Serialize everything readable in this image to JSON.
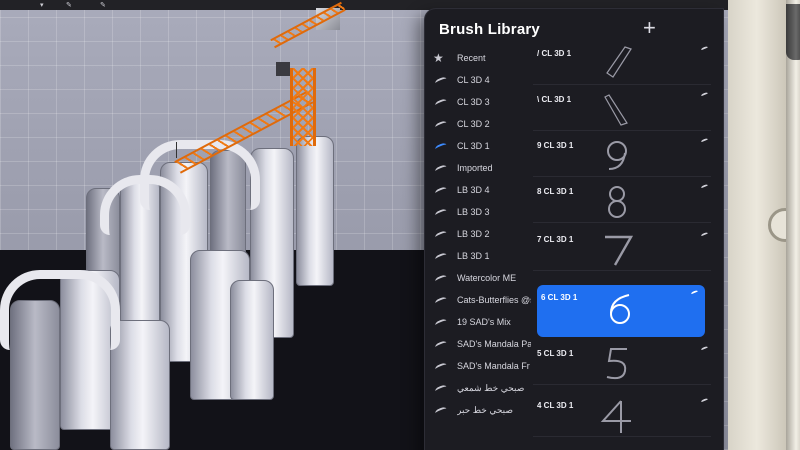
{
  "app": {
    "panel_title": "Brush Library",
    "add_button_label": "+"
  },
  "brush_sets": [
    {
      "label": "Recent",
      "icon": "star-icon"
    },
    {
      "label": "CL 3D 4",
      "icon": "brush-stroke-icon"
    },
    {
      "label": "CL 3D 3",
      "icon": "brush-stroke-icon"
    },
    {
      "label": "CL 3D 2",
      "icon": "brush-stroke-icon"
    },
    {
      "label": "CL 3D 1",
      "icon": "brush-stroke-icon",
      "active": true
    },
    {
      "label": "Imported",
      "icon": "brush-stroke-icon"
    },
    {
      "label": "LB 3D 4",
      "icon": "brush-stroke-icon"
    },
    {
      "label": "LB 3D 3",
      "icon": "brush-stroke-icon"
    },
    {
      "label": "LB 3D 2",
      "icon": "brush-stroke-icon"
    },
    {
      "label": "LB 3D 1",
      "icon": "brush-stroke-icon"
    },
    {
      "label": "Watercolor ME",
      "icon": "brush-stroke-icon"
    },
    {
      "label": "Cats-Butterflies @su...",
      "icon": "brush-stroke-icon"
    },
    {
      "label": "19 SAD's Mix",
      "icon": "brush-stroke-icon"
    },
    {
      "label": "SAD's Mandala Pa",
      "icon": "brush-stroke-icon"
    },
    {
      "label": "SAD's Mandala Fr",
      "icon": "brush-stroke-icon"
    },
    {
      "label": "صبحي خط شمعي",
      "icon": "brush-stroke-icon"
    },
    {
      "label": "صبحي خط حبر",
      "icon": "brush-stroke-icon"
    }
  ],
  "brushes": [
    {
      "name": "/ CL 3D 1",
      "preview": "slash"
    },
    {
      "name": "\\ CL 3D 1",
      "preview": "backslash"
    },
    {
      "name": "9 CL 3D 1",
      "preview": "9"
    },
    {
      "name": "8 CL 3D 1",
      "preview": "8"
    },
    {
      "name": "7 CL 3D 1",
      "preview": "7"
    },
    {
      "name": "6 CL 3D 1",
      "preview": "6",
      "selected": true
    },
    {
      "name": "5 CL 3D 1",
      "preview": "5"
    },
    {
      "name": "4 CL 3D 1",
      "preview": "4"
    }
  ],
  "colors": {
    "accent": "#1f6ff0",
    "panel_bg": "#1c1c22",
    "crane": "#f07a14"
  }
}
